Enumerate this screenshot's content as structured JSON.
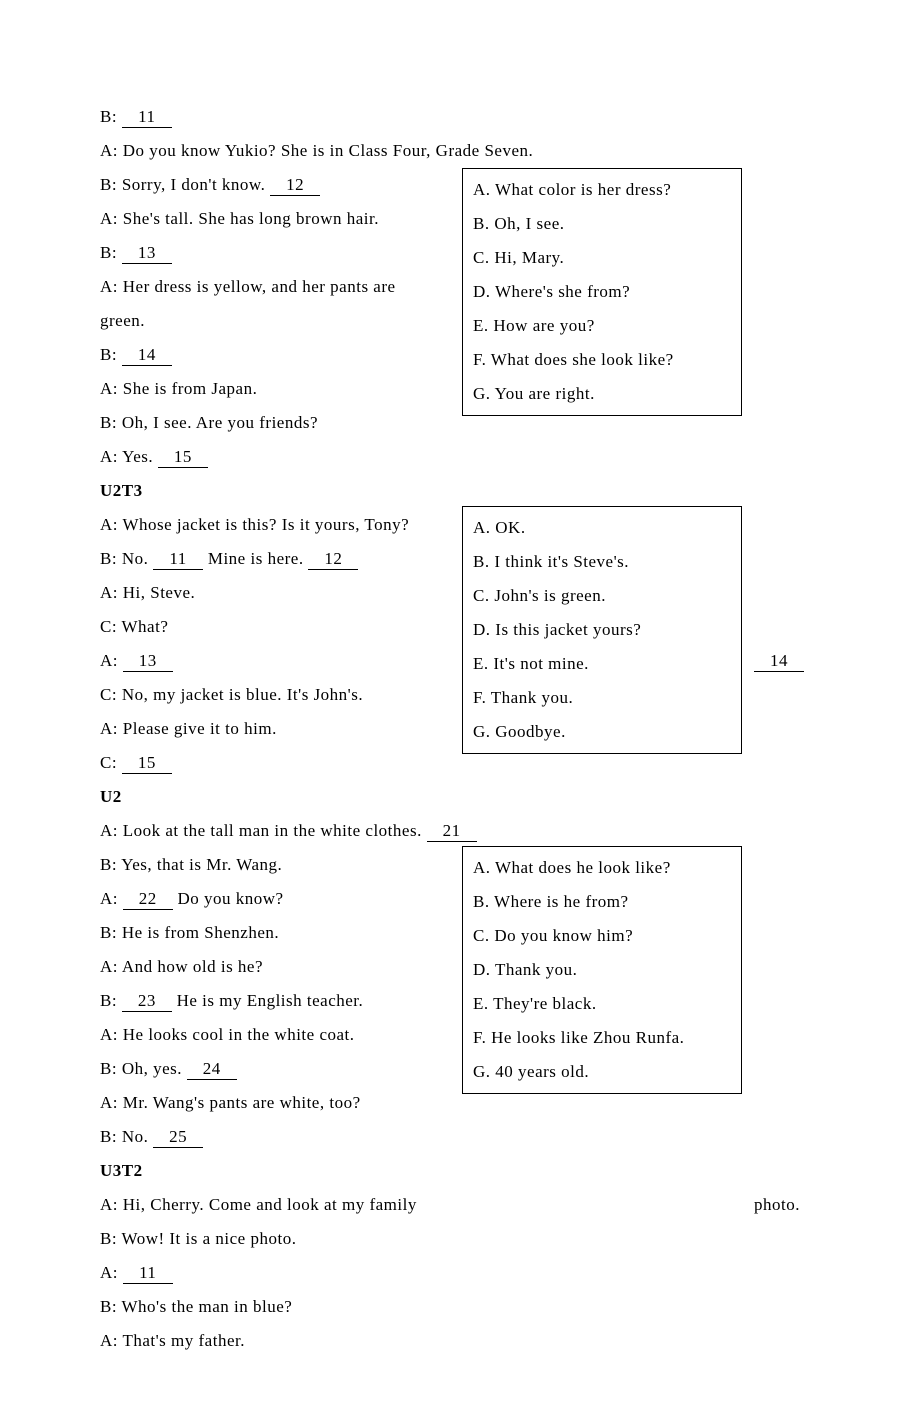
{
  "section1": {
    "lines": [
      {
        "p": "B: ",
        "blank": "11"
      },
      {
        "p": "A: ",
        "t": "Do you know Yukio? She is in Class Four, Grade Seven."
      },
      {
        "p": "B: ",
        "t": "Sorry, I don't know. ",
        "blank": "12"
      },
      {
        "p": "A: ",
        "t": "She's tall. She has long brown hair."
      },
      {
        "p": "B: ",
        "blank": "13"
      },
      {
        "p": "A: ",
        "t": "Her dress is yellow, and her pants are"
      },
      {
        "p": "",
        "t": "green."
      },
      {
        "p": "B: ",
        "blank": "14"
      },
      {
        "p": "A: ",
        "t": "She is from Japan."
      },
      {
        "p": "B: ",
        "t": "Oh, I see. Are you friends?"
      },
      {
        "p": "A: ",
        "t": "Yes. ",
        "blank": "15"
      }
    ],
    "options": [
      "A. What color is her dress?",
      "B. Oh, I see.",
      "C. Hi, Mary.",
      "D. Where's she from?",
      "E. How are you?",
      "F. What does she look like?",
      "G. You are right."
    ]
  },
  "section2": {
    "heading": "U2T3",
    "lines": [
      {
        "p": "A: ",
        "t": "Whose jacket is this? Is it yours, Tony?"
      },
      {
        "p": "B: ",
        "t": "No. ",
        "blank": "11",
        "t2": " Mine is here. ",
        "blank2": "12"
      },
      {
        "p": "A: ",
        "t": "Hi, Steve."
      },
      {
        "p": "C: ",
        "t": "What?"
      },
      {
        "p": "A: ",
        "blank": "13"
      },
      {
        "p": "C: ",
        "t": "No, my jacket is blue. It's John's."
      },
      {
        "p": "A: ",
        "t": "Please give it to him."
      },
      {
        "p": "C: ",
        "blank": "15"
      }
    ],
    "options": [
      "A. OK.",
      "B. I think it's Steve's.",
      "C. John's is green.",
      "D. Is this jacket yours?",
      "E. It's not mine.",
      "F. Thank you.",
      "G. Goodbye."
    ],
    "overflow14": "14"
  },
  "section3": {
    "heading": "U2",
    "lines": [
      {
        "p": "A: ",
        "t": "Look at the tall man in the white clothes. ",
        "blank": "21"
      },
      {
        "p": "B: ",
        "t": "Yes, that is Mr. Wang."
      },
      {
        "p": "A: ",
        "blank": "22",
        "t2": " Do you know?"
      },
      {
        "p": "B: ",
        "t": "He is from Shenzhen."
      },
      {
        "p": "A: ",
        "t": "And how old is he?"
      },
      {
        "p": "B: ",
        "blank": "23",
        "t2": " He is my English teacher."
      },
      {
        "p": "A: ",
        "t": "He looks cool in the white coat."
      },
      {
        "p": "B: ",
        "t": "Oh, yes. ",
        "blank": "24"
      },
      {
        "p": "A: ",
        "t": "Mr. Wang's pants are white, too?"
      },
      {
        "p": "B: ",
        "t": "No. ",
        "blank": "25"
      }
    ],
    "options": [
      "A. What does he look like?",
      "B. Where is he from?",
      "C. Do you know him?",
      "D. Thank you.",
      "E. They're black.",
      "F. He looks like Zhou Runfa.",
      "G. 40 years old."
    ]
  },
  "section4": {
    "heading": "U3T2",
    "lines": [
      {
        "p": "A: ",
        "t": "Hi, Cherry. Come and look at my family"
      },
      {
        "p": "B: ",
        "t": "Wow! It is a nice photo."
      },
      {
        "p": "A: ",
        "blank": "11"
      },
      {
        "p": "B: ",
        "t": "Who's the man in blue?"
      },
      {
        "p": "A: ",
        "t": "That's my father."
      }
    ],
    "overflowPhoto": "photo."
  }
}
